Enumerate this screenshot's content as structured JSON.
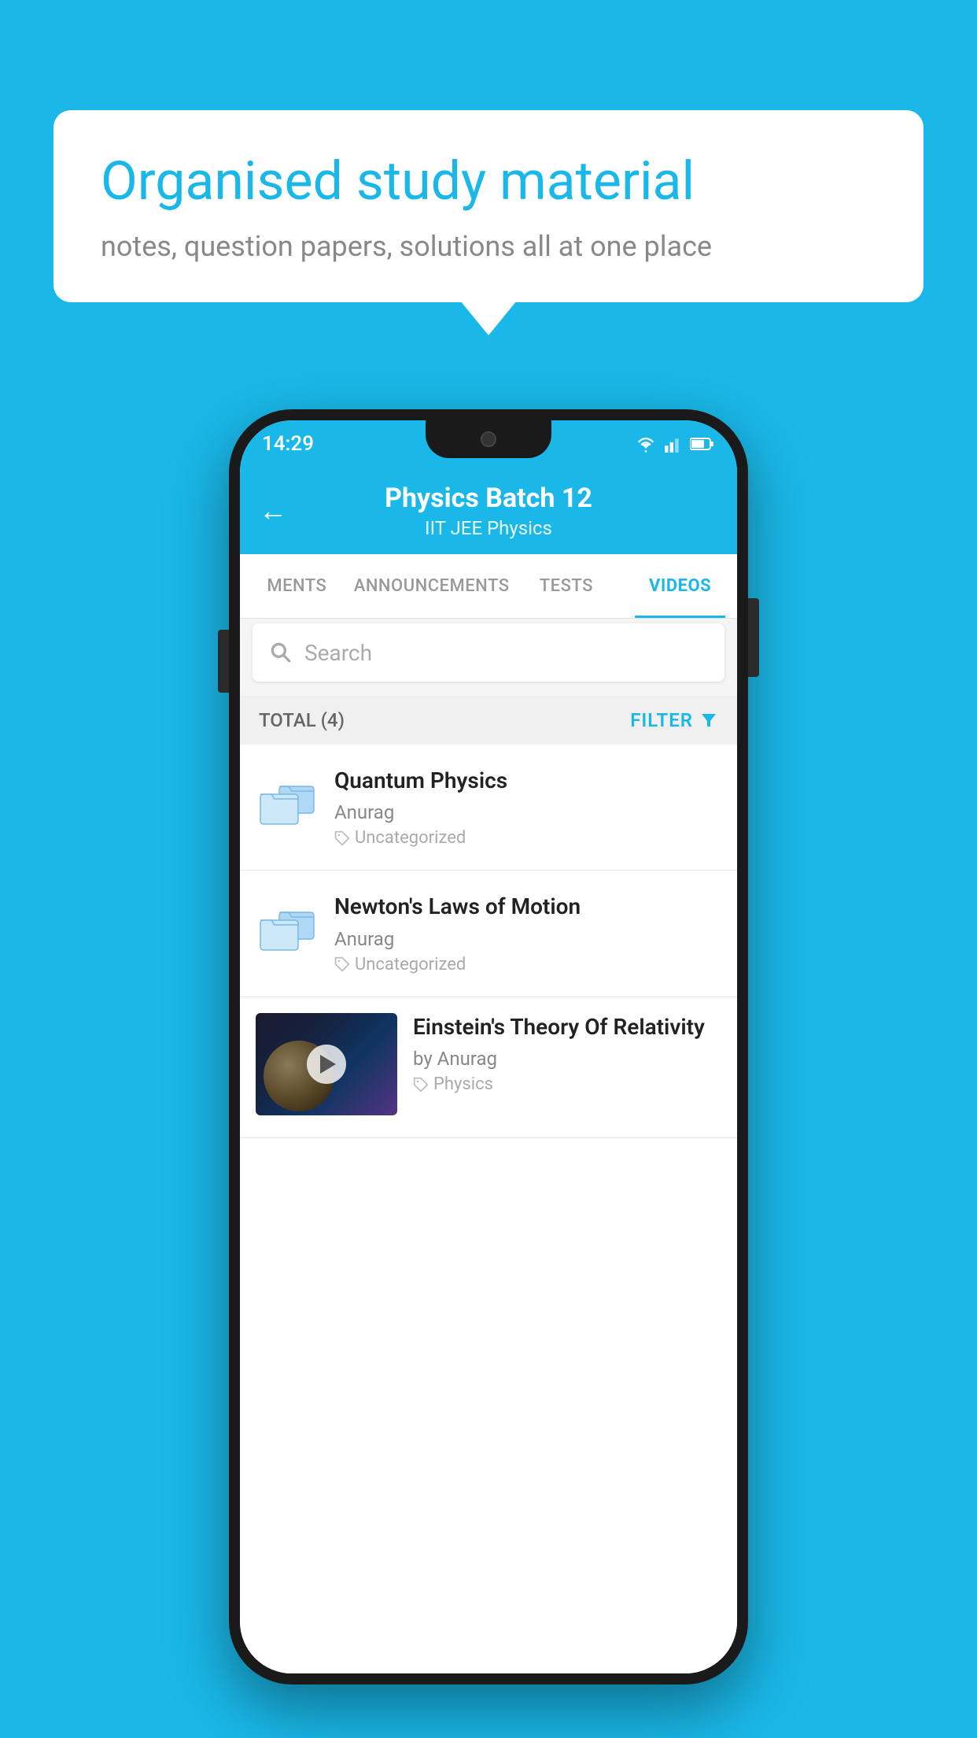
{
  "background": {
    "color": "#1ab8e8"
  },
  "speech_bubble": {
    "title": "Organised study material",
    "subtitle": "notes, question papers, solutions all at one place"
  },
  "phone": {
    "status_bar": {
      "time": "14:29"
    },
    "header": {
      "title": "Physics Batch 12",
      "subtitle": "IIT JEE   Physics",
      "back_label": "←"
    },
    "tabs": [
      {
        "label": "MENTS",
        "active": false
      },
      {
        "label": "ANNOUNCEMENTS",
        "active": false
      },
      {
        "label": "TESTS",
        "active": false
      },
      {
        "label": "VIDEOS",
        "active": true
      }
    ],
    "search": {
      "placeholder": "Search"
    },
    "filter": {
      "total_label": "TOTAL (4)",
      "filter_label": "FILTER"
    },
    "videos": [
      {
        "id": 1,
        "title": "Quantum Physics",
        "author": "Anurag",
        "tag": "Uncategorized",
        "type": "folder",
        "has_thumbnail": false
      },
      {
        "id": 2,
        "title": "Newton's Laws of Motion",
        "author": "Anurag",
        "tag": "Uncategorized",
        "type": "folder",
        "has_thumbnail": false
      },
      {
        "id": 3,
        "title": "Einstein's Theory Of Relativity",
        "author": "by Anurag",
        "tag": "Physics",
        "type": "video",
        "has_thumbnail": true
      }
    ]
  }
}
